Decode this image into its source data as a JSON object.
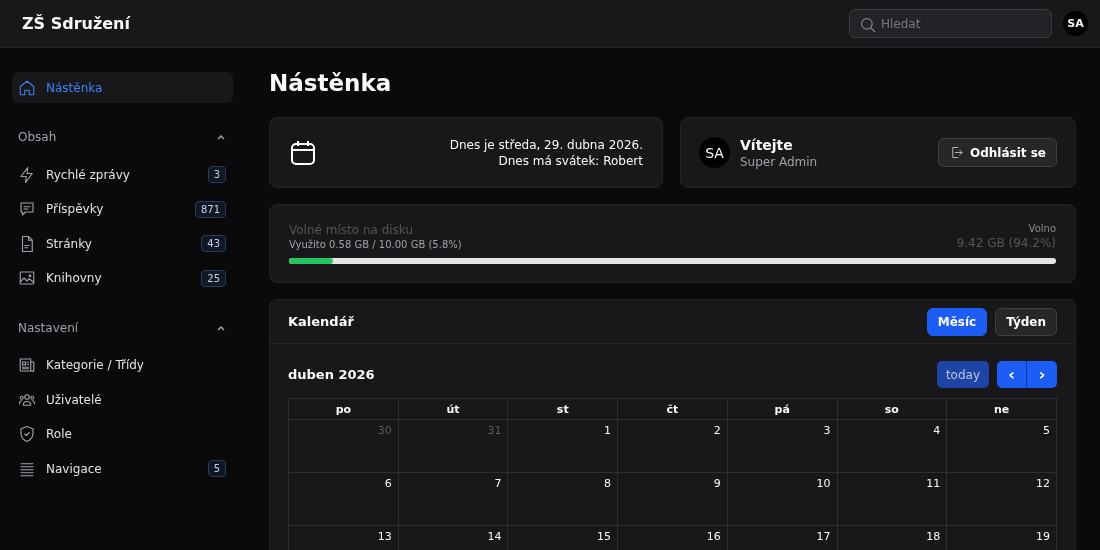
{
  "header": {
    "brand": "ZŠ Sdružení",
    "search": {
      "placeholder": "Hledat"
    },
    "avatar": "SA"
  },
  "sidebar": {
    "items": [
      {
        "label": "Nástěnka",
        "selected": true
      }
    ],
    "sections": [
      {
        "title": "Obsah",
        "expanded": true,
        "items": [
          {
            "label": "Rychlé zprávy",
            "badge": "3",
            "selected": false
          },
          {
            "label": "Příspěvky",
            "badge": "871",
            "selected": false
          },
          {
            "label": "Stránky",
            "badge": "43",
            "selected": false
          },
          {
            "label": "Knihovny",
            "badge": "25",
            "selected": false
          }
        ]
      },
      {
        "title": "Nastavení",
        "expanded": true,
        "items": [
          {
            "label": "Kategorie / Třídy",
            "selected": false
          },
          {
            "label": "Uživatelé",
            "selected": false
          },
          {
            "label": "Role",
            "selected": false
          },
          {
            "label": "Navigace",
            "badge": "5",
            "selected": false
          }
        ]
      }
    ]
  },
  "page_title": "Nástěnka",
  "date_card": {
    "line_1": "Dnes je středa, 29. dubna 2026.",
    "line_2": "Dnes má svátek: Robert"
  },
  "user_card": {
    "avatar": "SA",
    "greeting": "Vítejte",
    "role": "Super Admin",
    "logout_button": "Odhlásit se"
  },
  "disk_card": {
    "title": "Volné místo na disku",
    "used": "Využito 0.58 GB / 10.00 GB (5.8%)",
    "free_label": "Volno",
    "free_value": "9.42 GB (94.2%)",
    "level": 0.058
  },
  "calendar": {
    "title": "Kalendář",
    "views": [
      {
        "label": "Měsíc",
        "selected": true
      },
      {
        "label": "Týden",
        "selected": false
      }
    ],
    "month": "duben 2026",
    "today_button": "today",
    "prev_button": "‹",
    "next_button": "›",
    "weekdays": [
      "po",
      "út",
      "st",
      "čt",
      "pá",
      "so",
      "ne"
    ],
    "weeks": [
      [
        {
          "day": "30",
          "other_month": true
        },
        {
          "day": "31",
          "other_month": true
        },
        {
          "day": "1",
          "other_month": false
        },
        {
          "day": "2",
          "other_month": false
        },
        {
          "day": "3",
          "other_month": false
        },
        {
          "day": "4",
          "other_month": false
        },
        {
          "day": "5",
          "other_month": false
        }
      ],
      [
        {
          "day": "6",
          "other_month": false
        },
        {
          "day": "7",
          "other_month": false
        },
        {
          "day": "8",
          "other_month": false
        },
        {
          "day": "9",
          "other_month": false
        },
        {
          "day": "10",
          "other_month": false
        },
        {
          "day": "11",
          "other_month": false
        },
        {
          "day": "12",
          "other_month": false
        }
      ],
      [
        {
          "day": "13",
          "other_month": false
        },
        {
          "day": "14",
          "other_month": false
        },
        {
          "day": "15",
          "other_month": false
        },
        {
          "day": "16",
          "other_month": false
        },
        {
          "day": "17",
          "other_month": false
        },
        {
          "day": "18",
          "other_month": false
        },
        {
          "day": "19",
          "other_month": false
        }
      ]
    ]
  }
}
